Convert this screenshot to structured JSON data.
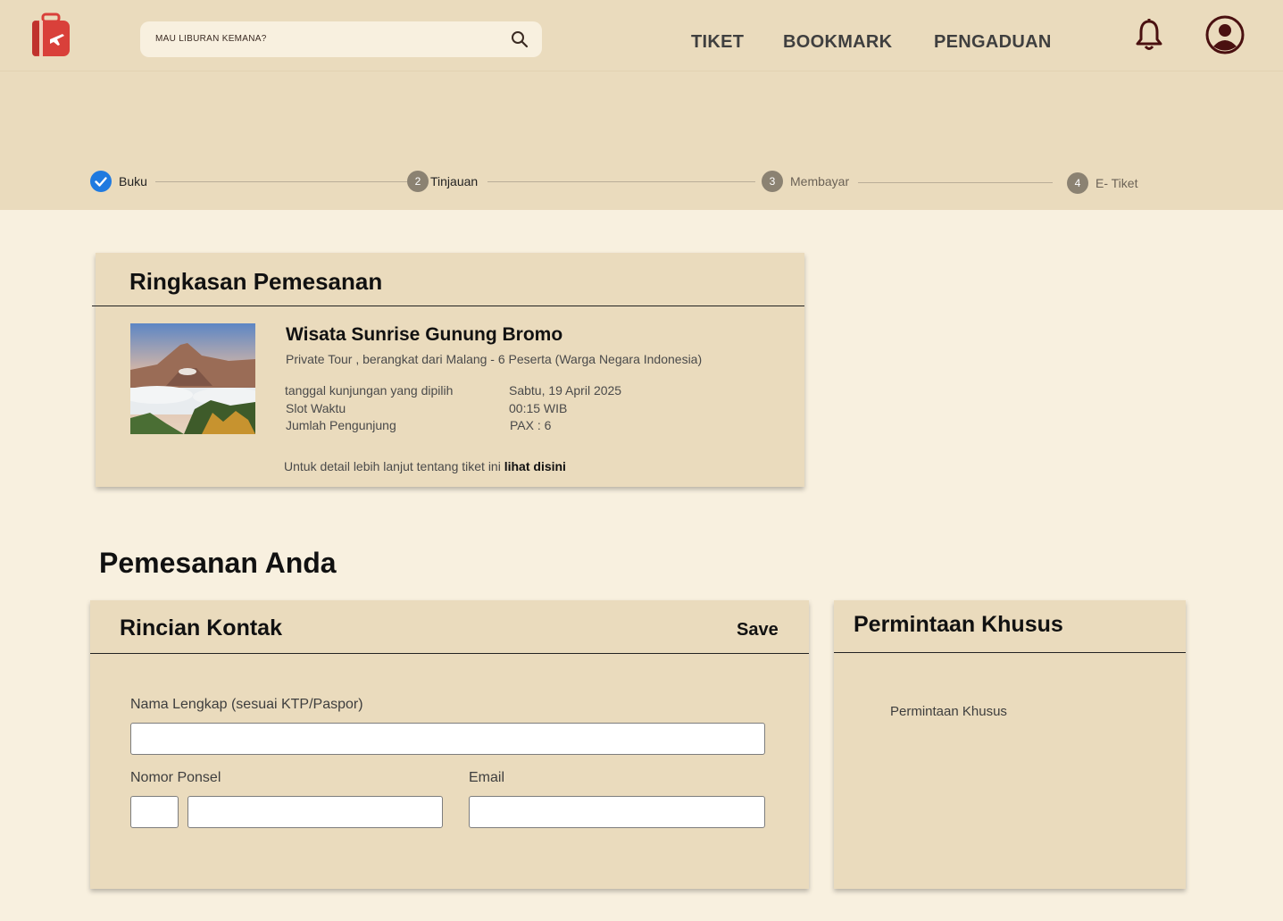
{
  "header": {
    "search_placeholder": "MAU LIBURAN KEMANA?",
    "nav": [
      "TIKET",
      "BOOKMARK",
      "PENGADUAN"
    ]
  },
  "stepper": {
    "steps": [
      {
        "number": "",
        "label": "Buku",
        "state": "done"
      },
      {
        "number": "2",
        "label": "Tinjauan",
        "state": "current"
      },
      {
        "number": "3",
        "label": "Membayar",
        "state": "pending"
      },
      {
        "number": "4",
        "label": "E- Tiket",
        "state": "pending"
      }
    ]
  },
  "summary": {
    "title": "Ringkasan Pemesanan",
    "tour_name": "Wisata Sunrise Gunung Bromo",
    "tour_subtitle": "Private Tour , berangkat dari Malang - 6 Peserta (Warga Negara Indonesia)",
    "details": [
      {
        "label": "tanggal kunjungan yang dipilih",
        "value": "Sabtu, 19 April 2025"
      },
      {
        "label": "Slot Waktu",
        "value": "00:15 WIB"
      },
      {
        "label": "Jumlah Pengunjung",
        "value": "PAX : 6"
      }
    ],
    "more_text": "Untuk detail lebih lanjut tentang tiket ini",
    "more_link": "lihat disini"
  },
  "booking": {
    "heading": "Pemesanan Anda",
    "contact": {
      "title": "Rincian Kontak",
      "save_label": "Save",
      "full_name_label": "Nama Lengkap (sesuai KTP/Paspor)",
      "full_name_value": "",
      "phone_label": "Nomor Ponsel",
      "phone_code_value": "",
      "phone_value": "",
      "email_label": "Email",
      "email_value": ""
    },
    "special": {
      "title": "Permintaan Khusus",
      "placeholder": "Permintaan Khusus"
    }
  },
  "colors": {
    "band": "#eadbbd",
    "page": "#f8f0df",
    "check": "#1f7ae0",
    "logo": "#d9403a",
    "icon_dark": "#4a1010"
  }
}
